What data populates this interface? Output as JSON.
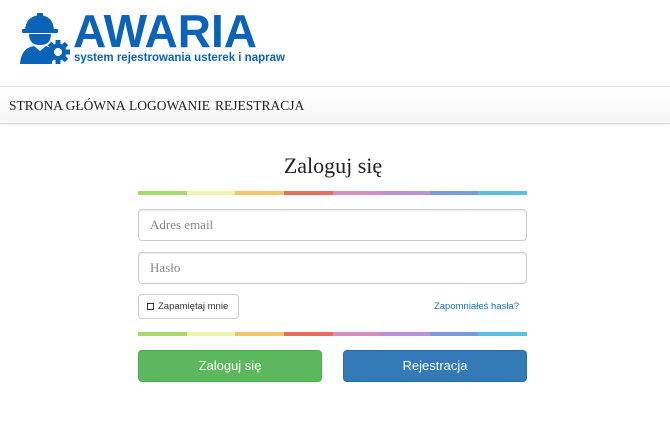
{
  "brand": {
    "title": "AWARIA",
    "subtitle": "system rejestrowania usterek i napraw",
    "logo_icon": "worker-gear-icon",
    "color": "#0b63b8"
  },
  "nav": {
    "items": [
      {
        "label": "STRONA GŁÓWNA"
      },
      {
        "label": "LOGOWANIE"
      },
      {
        "label": "REJESTRACJA"
      }
    ]
  },
  "login": {
    "title": "Zaloguj się",
    "email_placeholder": "Adres email",
    "email_value": "",
    "password_placeholder": "Hasło",
    "password_value": "",
    "remember_label": "Zapamiętaj mnie",
    "remember_checked": false,
    "forgot_label": "Zapomniałeś hasła?",
    "login_button": "Zaloguj się",
    "register_button": "Rejestracja"
  },
  "colors": {
    "rainbow": [
      "#a9d86e",
      "#f0f3b0",
      "#f1c76b",
      "#e46e63",
      "#d28fbf",
      "#b992d8",
      "#7b9bd8",
      "#5bc0de"
    ],
    "button_green": "#5cb85c",
    "button_blue": "#337ab7",
    "link": "#1a6fc4"
  }
}
